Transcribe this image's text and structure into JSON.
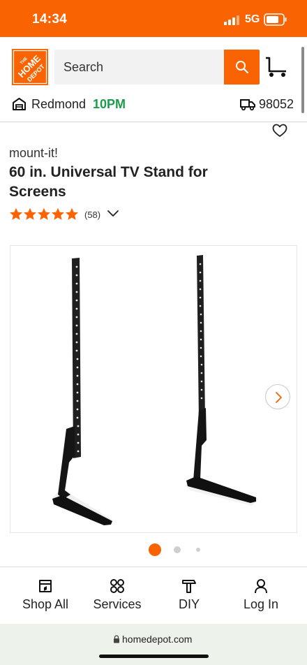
{
  "status_bar": {
    "time": "14:34",
    "network": "5G"
  },
  "header": {
    "logo_text": "THE HOME DEPOT",
    "search_placeholder": "Search",
    "store": {
      "name": "Redmond",
      "hours": "10PM"
    },
    "delivery_zip": "98052"
  },
  "product": {
    "brand": "mount-it!",
    "title": "60 in. Universal TV Stand for Screens",
    "rating": 5,
    "review_count": "(58)"
  },
  "gallery": {
    "slide_count": 3,
    "active_index": 0
  },
  "bottom_nav": {
    "items": [
      {
        "label": "Shop All",
        "icon": "shop-all-icon"
      },
      {
        "label": "Services",
        "icon": "services-icon"
      },
      {
        "label": "DIY",
        "icon": "hammer-icon"
      },
      {
        "label": "Log In",
        "icon": "user-icon"
      }
    ]
  },
  "browser": {
    "url": "homedepot.com"
  },
  "colors": {
    "brand_orange": "#f96302",
    "hours_green": "#1b9c4a",
    "url_bar_bg": "#edf2ea"
  }
}
